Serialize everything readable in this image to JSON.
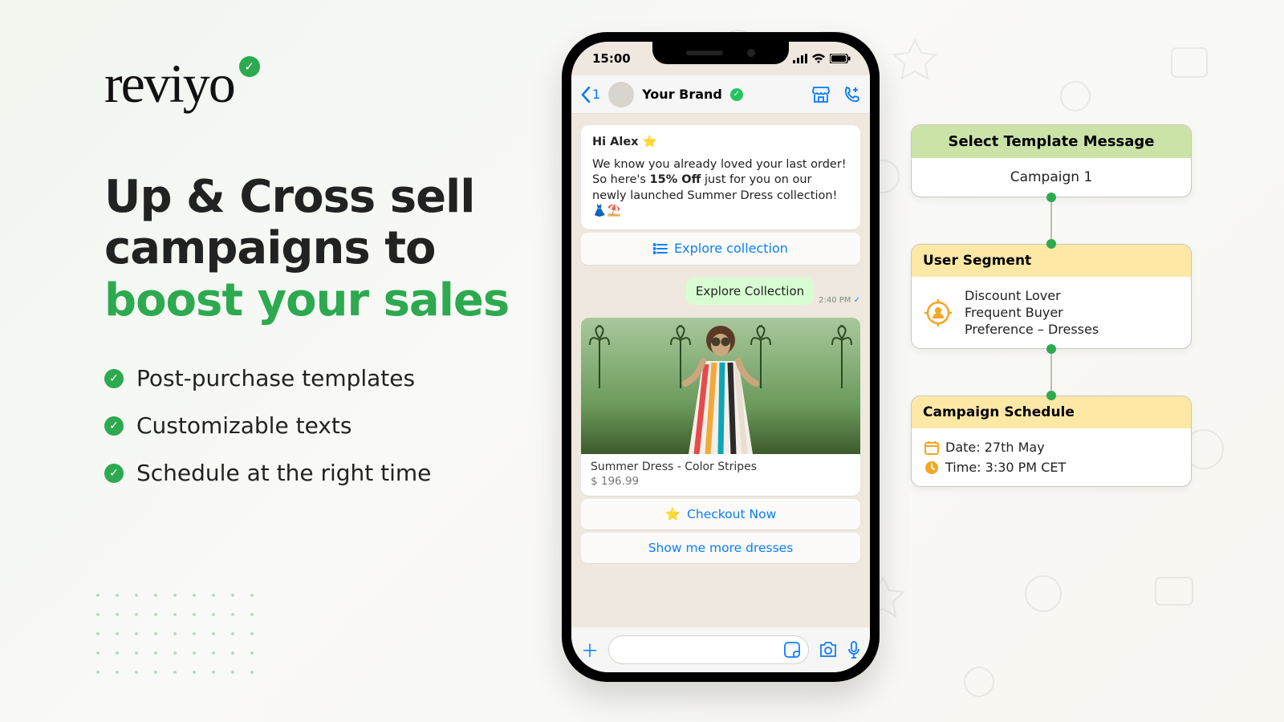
{
  "brand": {
    "name": "reviyo"
  },
  "headline": {
    "l1": "Up & Cross sell",
    "l2": "campaigns to",
    "l3accent": "boost your sales"
  },
  "bullets": [
    "Post-purchase templates",
    "Customizable texts",
    "Schedule at the right time"
  ],
  "phone": {
    "time": "15:00",
    "back_count": "1",
    "brand": "Your Brand",
    "msg": {
      "greeting": "Hi Alex ⭐",
      "body_before": "We know you already loved your last order! So here's ",
      "offer": "15% Off",
      "body_after": " just for you on our newly launched Summer Dress collection! 👗⛱️"
    },
    "explore_btn": "Explore collection",
    "reply_chip": "Explore Collection",
    "reply_time": "2:40 PM",
    "product": {
      "title": "Summer Dress - Color Stripes",
      "price": "$ 196.99"
    },
    "checkout_btn": "Checkout Now",
    "more_btn": "Show me more dresses"
  },
  "flow": {
    "template": {
      "title": "Select Template Message",
      "value": "Campaign 1"
    },
    "segment": {
      "title": "User Segment",
      "lines": [
        "Discount Lover",
        "Frequent Buyer",
        "Preference – Dresses"
      ]
    },
    "schedule": {
      "title": "Campaign Schedule",
      "date_label": "Date: ",
      "date": "27th May",
      "time_label": "Time: ",
      "time": "3:30 PM CET"
    }
  }
}
